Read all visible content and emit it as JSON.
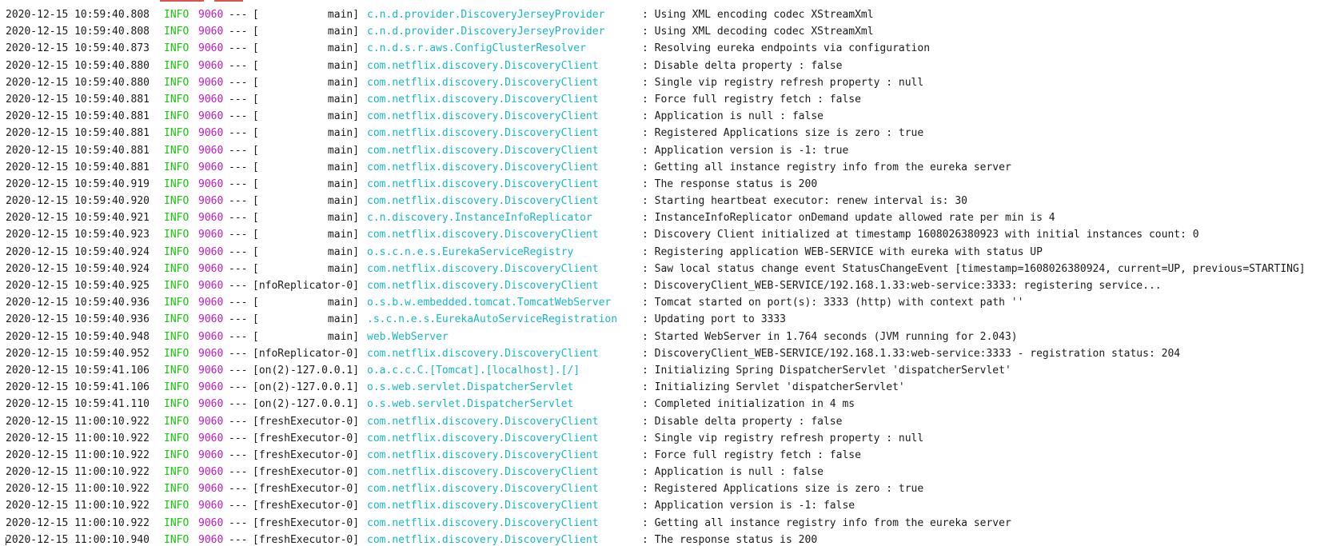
{
  "colors": {
    "timestamp": "#1a1a1a",
    "level": "#16c60c",
    "pid": "#c219c2",
    "logger": "#18b6c8",
    "message": "#1a1a1a"
  },
  "log": [
    {
      "ts": "2020-12-15 10:59:40.808",
      "level": "INFO",
      "pid": "9060",
      "sep": "---",
      "thread": "[           main]",
      "logger": "c.n.d.provider.DiscoveryJerseyProvider",
      "msg": ": Using XML encoding codec XStreamXml"
    },
    {
      "ts": "2020-12-15 10:59:40.808",
      "level": "INFO",
      "pid": "9060",
      "sep": "---",
      "thread": "[           main]",
      "logger": "c.n.d.provider.DiscoveryJerseyProvider",
      "msg": ": Using XML decoding codec XStreamXml"
    },
    {
      "ts": "2020-12-15 10:59:40.873",
      "level": "INFO",
      "pid": "9060",
      "sep": "---",
      "thread": "[           main]",
      "logger": "c.n.d.s.r.aws.ConfigClusterResolver",
      "msg": ": Resolving eureka endpoints via configuration"
    },
    {
      "ts": "2020-12-15 10:59:40.880",
      "level": "INFO",
      "pid": "9060",
      "sep": "---",
      "thread": "[           main]",
      "logger": "com.netflix.discovery.DiscoveryClient",
      "msg": ": Disable delta property : false"
    },
    {
      "ts": "2020-12-15 10:59:40.880",
      "level": "INFO",
      "pid": "9060",
      "sep": "---",
      "thread": "[           main]",
      "logger": "com.netflix.discovery.DiscoveryClient",
      "msg": ": Single vip registry refresh property : null"
    },
    {
      "ts": "2020-12-15 10:59:40.881",
      "level": "INFO",
      "pid": "9060",
      "sep": "---",
      "thread": "[           main]",
      "logger": "com.netflix.discovery.DiscoveryClient",
      "msg": ": Force full registry fetch : false"
    },
    {
      "ts": "2020-12-15 10:59:40.881",
      "level": "INFO",
      "pid": "9060",
      "sep": "---",
      "thread": "[           main]",
      "logger": "com.netflix.discovery.DiscoveryClient",
      "msg": ": Application is null : false"
    },
    {
      "ts": "2020-12-15 10:59:40.881",
      "level": "INFO",
      "pid": "9060",
      "sep": "---",
      "thread": "[           main]",
      "logger": "com.netflix.discovery.DiscoveryClient",
      "msg": ": Registered Applications size is zero : true"
    },
    {
      "ts": "2020-12-15 10:59:40.881",
      "level": "INFO",
      "pid": "9060",
      "sep": "---",
      "thread": "[           main]",
      "logger": "com.netflix.discovery.DiscoveryClient",
      "msg": ": Application version is -1: true"
    },
    {
      "ts": "2020-12-15 10:59:40.881",
      "level": "INFO",
      "pid": "9060",
      "sep": "---",
      "thread": "[           main]",
      "logger": "com.netflix.discovery.DiscoveryClient",
      "msg": ": Getting all instance registry info from the eureka server"
    },
    {
      "ts": "2020-12-15 10:59:40.919",
      "level": "INFO",
      "pid": "9060",
      "sep": "---",
      "thread": "[           main]",
      "logger": "com.netflix.discovery.DiscoveryClient",
      "msg": ": The response status is 200"
    },
    {
      "ts": "2020-12-15 10:59:40.920",
      "level": "INFO",
      "pid": "9060",
      "sep": "---",
      "thread": "[           main]",
      "logger": "com.netflix.discovery.DiscoveryClient",
      "msg": ": Starting heartbeat executor: renew interval is: 30"
    },
    {
      "ts": "2020-12-15 10:59:40.921",
      "level": "INFO",
      "pid": "9060",
      "sep": "---",
      "thread": "[           main]",
      "logger": "c.n.discovery.InstanceInfoReplicator",
      "msg": ": InstanceInfoReplicator onDemand update allowed rate per min is 4"
    },
    {
      "ts": "2020-12-15 10:59:40.923",
      "level": "INFO",
      "pid": "9060",
      "sep": "---",
      "thread": "[           main]",
      "logger": "com.netflix.discovery.DiscoveryClient",
      "msg": ": Discovery Client initialized at timestamp 1608026380923 with initial instances count: 0"
    },
    {
      "ts": "2020-12-15 10:59:40.924",
      "level": "INFO",
      "pid": "9060",
      "sep": "---",
      "thread": "[           main]",
      "logger": "o.s.c.n.e.s.EurekaServiceRegistry",
      "msg": ": Registering application WEB-SERVICE with eureka with status UP"
    },
    {
      "ts": "2020-12-15 10:59:40.924",
      "level": "INFO",
      "pid": "9060",
      "sep": "---",
      "thread": "[           main]",
      "logger": "com.netflix.discovery.DiscoveryClient",
      "msg": ": Saw local status change event StatusChangeEvent [timestamp=1608026380924, current=UP, previous=STARTING]"
    },
    {
      "ts": "2020-12-15 10:59:40.925",
      "level": "INFO",
      "pid": "9060",
      "sep": "---",
      "thread": "[nfoReplicator-0]",
      "logger": "com.netflix.discovery.DiscoveryClient",
      "msg": ": DiscoveryClient_WEB-SERVICE/192.168.1.33:web-service:3333: registering service..."
    },
    {
      "ts": "2020-12-15 10:59:40.936",
      "level": "INFO",
      "pid": "9060",
      "sep": "---",
      "thread": "[           main]",
      "logger": "o.s.b.w.embedded.tomcat.TomcatWebServer",
      "msg": ": Tomcat started on port(s): 3333 (http) with context path ''"
    },
    {
      "ts": "2020-12-15 10:59:40.936",
      "level": "INFO",
      "pid": "9060",
      "sep": "---",
      "thread": "[           main]",
      "logger": ".s.c.n.e.s.EurekaAutoServiceRegistration",
      "msg": ": Updating port to 3333"
    },
    {
      "ts": "2020-12-15 10:59:40.948",
      "level": "INFO",
      "pid": "9060",
      "sep": "---",
      "thread": "[           main]",
      "logger": "web.WebServer",
      "msg": ": Started WebServer in 1.764 seconds (JVM running for 2.043)"
    },
    {
      "ts": "2020-12-15 10:59:40.952",
      "level": "INFO",
      "pid": "9060",
      "sep": "---",
      "thread": "[nfoReplicator-0]",
      "logger": "com.netflix.discovery.DiscoveryClient",
      "msg": ": DiscoveryClient_WEB-SERVICE/192.168.1.33:web-service:3333 - registration status: 204"
    },
    {
      "ts": "2020-12-15 10:59:41.106",
      "level": "INFO",
      "pid": "9060",
      "sep": "---",
      "thread": "[on(2)-127.0.0.1]",
      "logger": "o.a.c.c.C.[Tomcat].[localhost].[/]",
      "msg": ": Initializing Spring DispatcherServlet 'dispatcherServlet'"
    },
    {
      "ts": "2020-12-15 10:59:41.106",
      "level": "INFO",
      "pid": "9060",
      "sep": "---",
      "thread": "[on(2)-127.0.0.1]",
      "logger": "o.s.web.servlet.DispatcherServlet",
      "msg": ": Initializing Servlet 'dispatcherServlet'"
    },
    {
      "ts": "2020-12-15 10:59:41.110",
      "level": "INFO",
      "pid": "9060",
      "sep": "---",
      "thread": "[on(2)-127.0.0.1]",
      "logger": "o.s.web.servlet.DispatcherServlet",
      "msg": ": Completed initialization in 4 ms"
    },
    {
      "ts": "2020-12-15 11:00:10.922",
      "level": "INFO",
      "pid": "9060",
      "sep": "---",
      "thread": "[freshExecutor-0]",
      "logger": "com.netflix.discovery.DiscoveryClient",
      "msg": ": Disable delta property : false"
    },
    {
      "ts": "2020-12-15 11:00:10.922",
      "level": "INFO",
      "pid": "9060",
      "sep": "---",
      "thread": "[freshExecutor-0]",
      "logger": "com.netflix.discovery.DiscoveryClient",
      "msg": ": Single vip registry refresh property : null"
    },
    {
      "ts": "2020-12-15 11:00:10.922",
      "level": "INFO",
      "pid": "9060",
      "sep": "---",
      "thread": "[freshExecutor-0]",
      "logger": "com.netflix.discovery.DiscoveryClient",
      "msg": ": Force full registry fetch : false"
    },
    {
      "ts": "2020-12-15 11:00:10.922",
      "level": "INFO",
      "pid": "9060",
      "sep": "---",
      "thread": "[freshExecutor-0]",
      "logger": "com.netflix.discovery.DiscoveryClient",
      "msg": ": Application is null : false"
    },
    {
      "ts": "2020-12-15 11:00:10.922",
      "level": "INFO",
      "pid": "9060",
      "sep": "---",
      "thread": "[freshExecutor-0]",
      "logger": "com.netflix.discovery.DiscoveryClient",
      "msg": ": Registered Applications size is zero : true"
    },
    {
      "ts": "2020-12-15 11:00:10.922",
      "level": "INFO",
      "pid": "9060",
      "sep": "---",
      "thread": "[freshExecutor-0]",
      "logger": "com.netflix.discovery.DiscoveryClient",
      "msg": ": Application version is -1: false"
    },
    {
      "ts": "2020-12-15 11:00:10.922",
      "level": "INFO",
      "pid": "9060",
      "sep": "---",
      "thread": "[freshExecutor-0]",
      "logger": "com.netflix.discovery.DiscoveryClient",
      "msg": ": Getting all instance registry info from the eureka server"
    },
    {
      "ts": "2020-12-15 11:00:10.940",
      "level": "INFO",
      "pid": "9060",
      "sep": "---",
      "thread": "[freshExecutor-0]",
      "logger": "com.netflix.discovery.DiscoveryClient",
      "msg": ": The response status is 200"
    }
  ]
}
